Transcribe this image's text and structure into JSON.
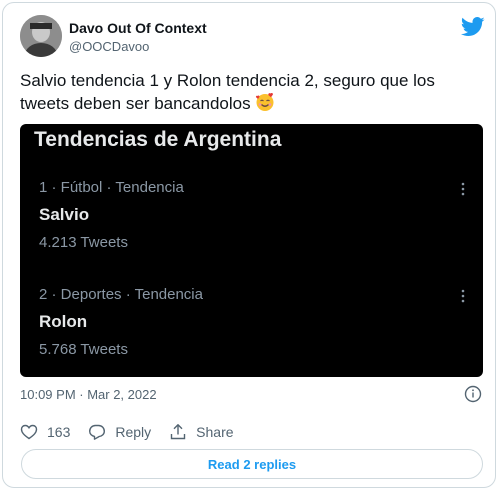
{
  "author": {
    "name": "Davo Out Of Context",
    "handle": "@OOCDavoo"
  },
  "tweet": {
    "text": "Salvio tendencia 1 y Rolon tendencia 2, seguro que los tweets deben ser bancandolos",
    "emoji_icon": "smiling-face-with-hearts-icon",
    "timestamp": "10:09 PM · Mar 2, 2022"
  },
  "embedded_screenshot": {
    "title": "Tendencias de Argentina",
    "trends": [
      {
        "meta": "1 · Fútbol · Tendencia",
        "name": "Salvio",
        "count": "4.213 Tweets"
      },
      {
        "meta": "2 · Deportes · Tendencia",
        "name": "Rolon",
        "count": "5.768 Tweets"
      }
    ]
  },
  "actions": {
    "like_count": "163",
    "reply_label": "Reply",
    "share_label": "Share",
    "read_replies_label": "Read 2 replies"
  },
  "colors": {
    "accent": "#1d9bf0",
    "secondary_text": "#536471",
    "border": "#cfd9de",
    "screenshot_bg": "#000000"
  }
}
